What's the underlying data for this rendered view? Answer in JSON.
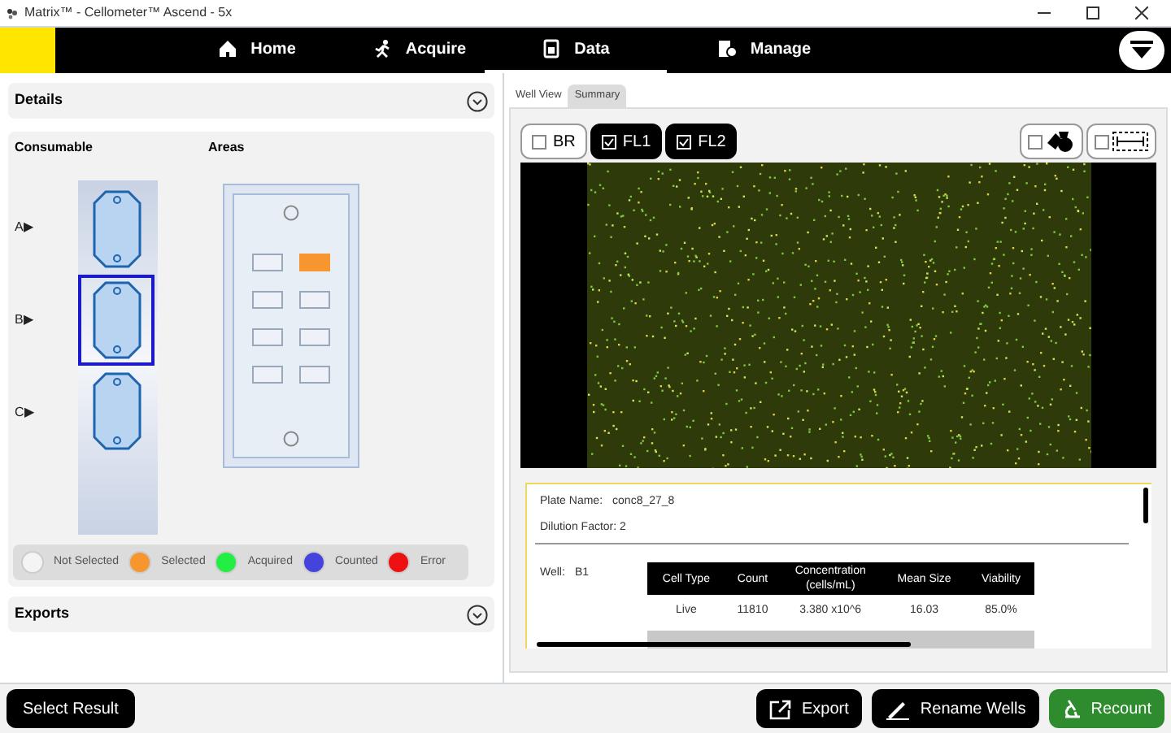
{
  "window": {
    "title": "Matrix™ - Cellometer™ Ascend - 5x"
  },
  "nav": {
    "tabs": [
      {
        "label": "Home",
        "selected": false
      },
      {
        "label": "Acquire",
        "selected": false
      },
      {
        "label": "Data",
        "selected": true
      },
      {
        "label": "Manage",
        "selected": false
      }
    ]
  },
  "details": {
    "title": "Details",
    "consumable_label": "Consumable",
    "areas_label": "Areas",
    "wells": [
      {
        "label": "A▶",
        "selected": false
      },
      {
        "label": "B▶",
        "selected": true
      },
      {
        "label": "C▶",
        "selected": false
      }
    ],
    "areas": [
      {
        "selected": false
      },
      {
        "selected": true
      },
      {
        "selected": false
      },
      {
        "selected": false
      },
      {
        "selected": false
      },
      {
        "selected": false
      },
      {
        "selected": false
      },
      {
        "selected": false
      }
    ],
    "legend": [
      {
        "label": "Not Selected",
        "color": "#f4f4f4"
      },
      {
        "label": "Selected",
        "color": "#f7962e"
      },
      {
        "label": "Acquired",
        "color": "#22ee44"
      },
      {
        "label": "Counted",
        "color": "#4444dd"
      },
      {
        "label": "Error",
        "color": "#ee1111"
      }
    ]
  },
  "exports": {
    "title": "Exports"
  },
  "view_tabs": [
    {
      "label": "Well View",
      "selected": false
    },
    {
      "label": "Summary",
      "selected": true
    }
  ],
  "channels": [
    {
      "label": "BR",
      "checked": false
    },
    {
      "label": "FL1",
      "checked": true
    },
    {
      "label": "FL2",
      "checked": true
    }
  ],
  "overlays": [
    {
      "kind": "shapes",
      "checked": false
    },
    {
      "kind": "scale",
      "checked": false
    }
  ],
  "summary": {
    "plate_name_label": "Plate Name:",
    "plate_name": "conc8_27_8",
    "dilution": "Dilution Factor: 2",
    "well_label": "Well:",
    "well": "B1",
    "table": {
      "columns": [
        "Cell Type",
        "Count",
        "Concentration (cells/mL)",
        "Mean Size",
        "Viability"
      ],
      "rows": [
        [
          "Live",
          "11810",
          "3.380 x10^6",
          "16.03",
          "85.0%"
        ]
      ]
    }
  },
  "buttons": {
    "select_result": "Select Result",
    "export": "Export",
    "rename_wells": "Rename Wells",
    "recount": "Recount"
  }
}
